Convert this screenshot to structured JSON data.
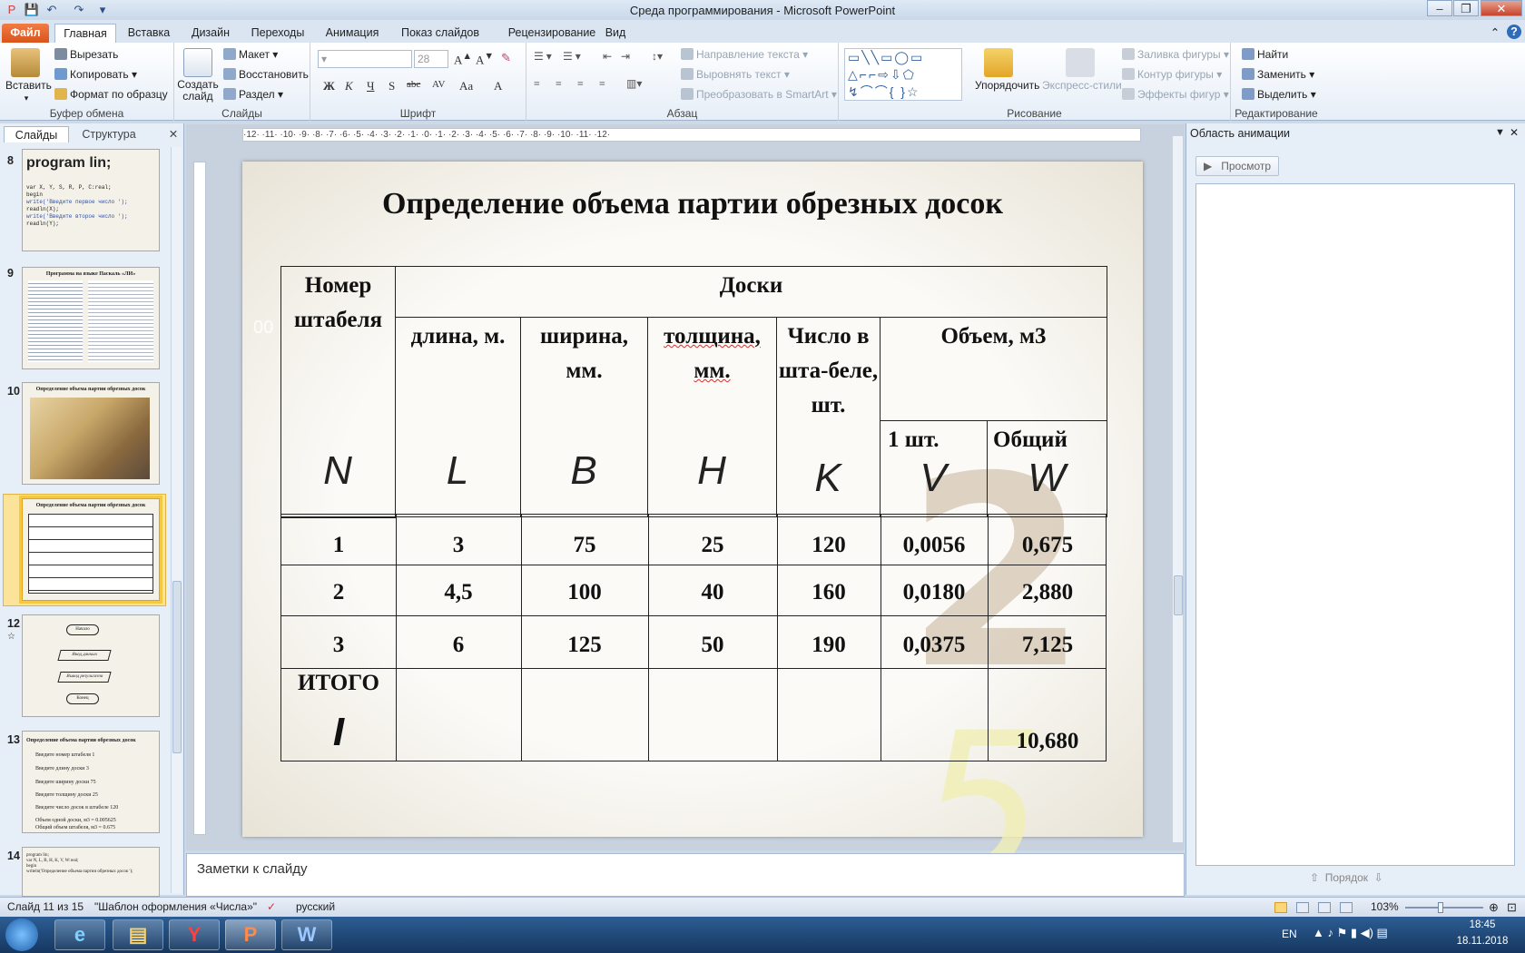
{
  "window": {
    "title": "Среда программирования  -  Microsoft PowerPoint",
    "btn_minimize": "–",
    "btn_maximize": "❐",
    "btn_close": "✕"
  },
  "tabs": [
    "Файл",
    "Главная",
    "Вставка",
    "Дизайн",
    "Переходы",
    "Анимация",
    "Показ слайдов",
    "Рецензирование",
    "Вид"
  ],
  "ribbon": {
    "clipboard": {
      "label": "Буфер обмена",
      "paste": "Вставить",
      "cut": "Вырезать",
      "copy": "Копировать",
      "format_painter": "Формат по образцу"
    },
    "slides": {
      "label": "Слайды",
      "new_slide": "Создать слайд",
      "layout": "Макет",
      "reset": "Восстановить",
      "section": "Раздел"
    },
    "font": {
      "label": "Шрифт",
      "font_size": "28",
      "bold": "Ж",
      "italic": "К",
      "underline": "Ч",
      "shadow": "S",
      "strike": "abc",
      "spacing": "AV",
      "case": "Aa",
      "color": "A"
    },
    "paragraph": {
      "label": "Абзац",
      "text_direction": "Направление текста",
      "align_text": "Выровнять текст",
      "smartart": "Преобразовать в SmartArt"
    },
    "drawing": {
      "label": "Рисование",
      "arrange": "Упорядочить",
      "quick_styles": "Экспресс-стили",
      "fill": "Заливка фигуры",
      "outline": "Контур фигуры",
      "effects": "Эффекты фигур"
    },
    "editing": {
      "label": "Редактирование",
      "find": "Найти",
      "replace": "Заменить",
      "select": "Выделить"
    }
  },
  "left_pane": {
    "tab_slides": "Слайды",
    "tab_outline": "Структура",
    "slides": [
      {
        "num": "8",
        "title": "program lin;",
        "lines": [
          "program lin;",
          "var X, Y, S, R, P, C:real;",
          "begin",
          "write('Введите первое число ');",
          "readln(X);",
          "write('Введите второе число ');",
          "readln(Y);"
        ]
      },
      {
        "num": "9",
        "title": "Программа на языке Паскаль «ЛИ»",
        "lines": []
      },
      {
        "num": "10",
        "title": "Определение объема партии обрезных досок",
        "lines": []
      },
      {
        "num": "11",
        "title": "Определение объема партии обрезных досок",
        "lines": []
      },
      {
        "num": "12",
        "title": "",
        "lines": [
          "Начало",
          "Ввод данных",
          "Вывод результатов",
          "Конец"
        ]
      },
      {
        "num": "13",
        "title": "Определение объема партии обрезных досок",
        "lines": [
          "Введите номер штабеля 1",
          "Введите длину доски 3",
          "Введите ширину доски 75",
          "Введите толщину доски 25",
          "Введите число досок в штабеле 120",
          "Объем одной доски, м3 = 0.005625",
          "Общий объем штабеля, м3 = 0.675"
        ]
      },
      {
        "num": "14",
        "title": "",
        "lines": [
          "program lin;",
          "var N, L, B, H, K, V, W:real;",
          "begin",
          "writeln('Определение объема партии обрезных досок ');"
        ]
      }
    ]
  },
  "ruler_text": "·12· ·11· ·10· ·9· ·8· ·7· ·6· ·5· ·4· ·3· ·2· ·1· ·0· ·1· ·2· ·3· ·4· ·5· ·6· ·7· ·8· ·9· ·10· ·11· ·12·",
  "slide": {
    "title": "Определение объема партии обрезных досок",
    "side_text": "00",
    "table": {
      "h_number": "Номер штабеля",
      "h_boards": "Доски",
      "h_length": "длина, м.",
      "h_width": "ширина, мм.",
      "h_thickness": "толщина, мм.",
      "h_count": "Число в шта-беле, шт.",
      "h_volume": "Объем, м3",
      "h_one": "1 шт.",
      "h_total": "Общий",
      "sym": [
        "N",
        "L",
        "B",
        "H",
        "K",
        "V",
        "W"
      ],
      "rows": [
        [
          "1",
          "3",
          "75",
          "25",
          "120",
          "0,0056",
          "0,675"
        ],
        [
          "2",
          "4,5",
          "100",
          "40",
          "160",
          "0,0180",
          "2,880"
        ],
        [
          "3",
          "6",
          "125",
          "50",
          "190",
          "0,0375",
          "7,125"
        ]
      ],
      "total_label": "ИТОГО",
      "total_sym": "I",
      "total_value": "10,680"
    }
  },
  "notes_placeholder": "Заметки к слайду",
  "right_pane": {
    "title": "Область анимации",
    "preview": "Просмотр",
    "order": "Порядок"
  },
  "status": {
    "slide": "Слайд 11 из 15",
    "theme": "\"Шаблон оформления «Числа»\"",
    "language": "русский",
    "zoom": "103%"
  },
  "taskbar": {
    "lang": "EN",
    "time": "18:45",
    "date": "18.11.2018"
  }
}
